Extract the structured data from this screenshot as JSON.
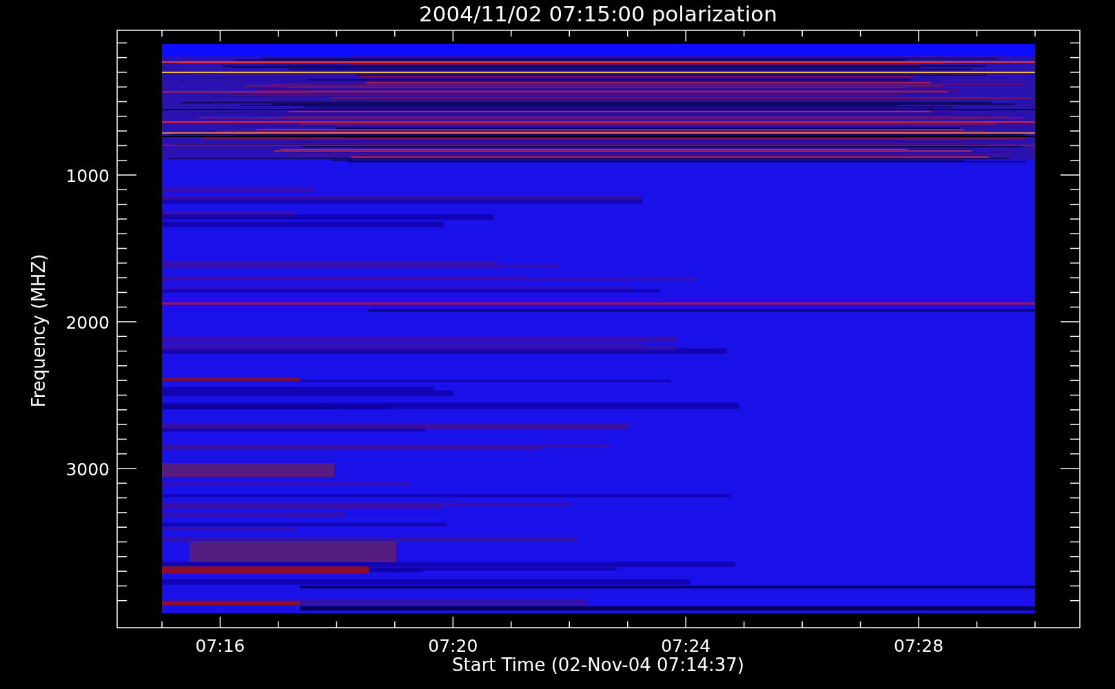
{
  "title": "2004/11/02 07:15:00 polarization",
  "x_axis": {
    "title": "Start Time (02-Nov-04 07:14:37)",
    "labels": [
      "07:16",
      "07:20",
      "07:24",
      "07:28"
    ]
  },
  "y_axis": {
    "title": "Frequency (MHZ)",
    "labels": [
      "1000",
      "2000",
      "3000"
    ]
  }
}
